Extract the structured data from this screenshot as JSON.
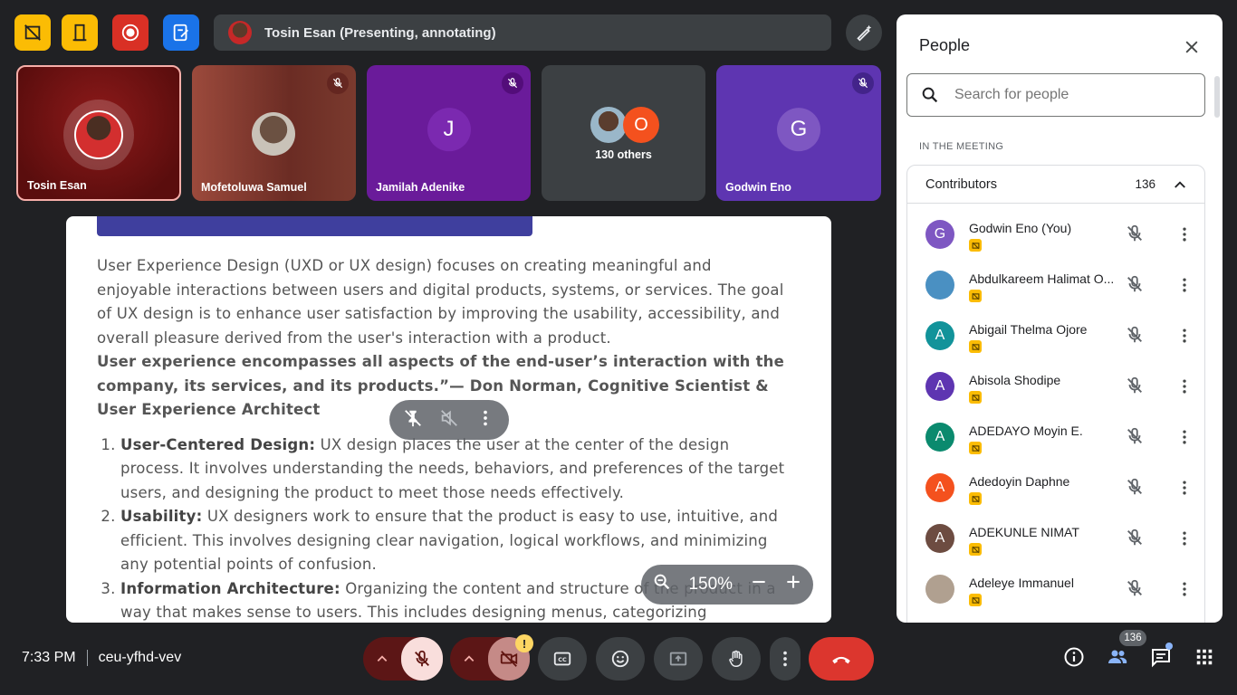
{
  "presenting": {
    "label": "Tosin Esan (Presenting, annotating)"
  },
  "tiles": [
    {
      "name": "Tosin Esan"
    },
    {
      "name": "Mofetoluwa Samuel"
    },
    {
      "name": "Jamilah Adenike",
      "initial": "J"
    },
    {
      "others": "130 others",
      "initial": "O"
    },
    {
      "name": "Godwin Eno",
      "initial": "G"
    }
  ],
  "slide": {
    "para": "User Experience Design (UXD or UX design) focuses on creating meaningful and enjoyable interactions between users and digital products, systems, or services. The goal of UX design is to enhance user satisfaction by improving the usability, accessibility, and overall pleasure derived from the user's interaction with a product.",
    "quote": "User experience encompasses all aspects of the end-user’s interaction with the company, its services, and its products.”— Don Norman, Cognitive Scientist & User Experience Architect",
    "items": [
      {
        "title": "User-Centered Design:",
        "text": " UX design places the user at the center of the design process. It involves understanding the needs, behaviors, and preferences of the target users, and designing the product to meet those needs effectively."
      },
      {
        "title": "Usability:",
        "text": " UX designers work to ensure that the product is easy to use, intuitive, and efficient. This involves designing clear navigation, logical workflows, and minimizing any potential points of confusion."
      },
      {
        "title": "Information Architecture:",
        "text": " Organizing the content and structure of the product in a way that makes sense to users. This includes designing menus, categorizing"
      }
    ],
    "zoom": "150%"
  },
  "people": {
    "title": "People",
    "search_placeholder": "Search for people",
    "section": "IN THE MEETING",
    "group": "Contributors",
    "count": "136",
    "list": [
      {
        "name": "Godwin Eno (You)",
        "initial": "G",
        "color": "#7e57c2"
      },
      {
        "name": "Abdulkareem Halimat O...",
        "initial": "",
        "color": "#4a90c2"
      },
      {
        "name": "Abigail Thelma Ojore",
        "initial": "A",
        "color": "#12939a"
      },
      {
        "name": "Abisola Shodipe",
        "initial": "A",
        "color": "#5e35b1"
      },
      {
        "name": "ADEDAYO Moyin E.",
        "initial": "A",
        "color": "#0b8a6e"
      },
      {
        "name": "Adedoyin Daphne",
        "initial": "A",
        "color": "#f4511e"
      },
      {
        "name": "ADEKUNLE NIMAT",
        "initial": "A",
        "color": "#6d4c41"
      },
      {
        "name": "Adeleye Immanuel",
        "initial": "",
        "color": "#b0a090"
      }
    ]
  },
  "footer": {
    "time": "7:33 PM",
    "code": "ceu-yfhd-vev",
    "people_badge": "136",
    "cam_warning": "!"
  }
}
